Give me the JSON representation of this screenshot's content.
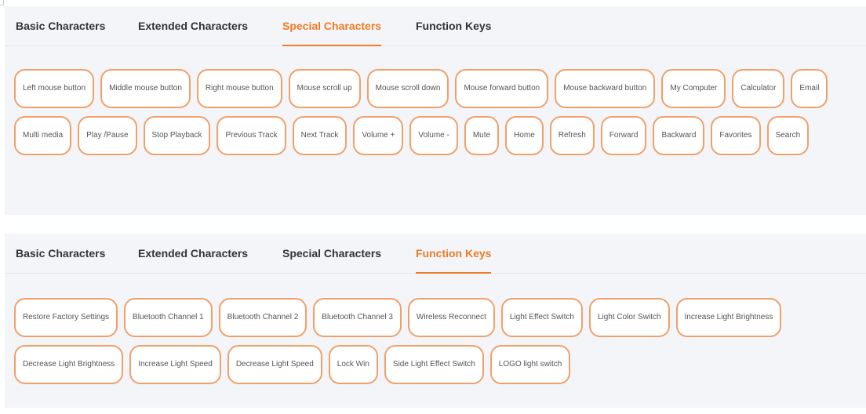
{
  "panels": [
    {
      "tabs": [
        "Basic Characters",
        "Extended Characters",
        "Special Characters",
        "Function Keys"
      ],
      "active_tab": 2,
      "keys": [
        "Left mouse button",
        "Middle mouse button",
        "Right mouse button",
        "Mouse scroll up",
        "Mouse scroll down",
        "Mouse forward button",
        "Mouse backward button",
        "My Computer",
        "Calculator",
        "Email",
        "Multi media",
        "Play /Pause",
        "Stop Playback",
        "Previous Track",
        "Next Track",
        "Volume +",
        "Volume -",
        "Mute",
        "Home",
        "Refresh",
        "Forward",
        "Backward",
        "Favorites",
        "Search"
      ]
    },
    {
      "tabs": [
        "Basic Characters",
        "Extended Characters",
        "Special Characters",
        "Function Keys"
      ],
      "active_tab": 3,
      "keys": [
        "Restore Factory Settings",
        "Bluetooth Channel 1",
        "Bluetooth Channel 2",
        "Bluetooth Channel 3",
        "Wireless Reconnect",
        "Light Effect Switch",
        "Light Color Switch",
        "Increase Light Brightness",
        "Decrease Light Brightness",
        "Increase Light Speed",
        "Decrease Light Speed",
        "Lock Win",
        "Side Light Effect Switch",
        "LOGO light switch"
      ]
    }
  ],
  "colors": {
    "accent": "#f07b24",
    "chip_border": "#f1a06a",
    "panel_bg": "#f3f5f9",
    "text": "#333333"
  }
}
